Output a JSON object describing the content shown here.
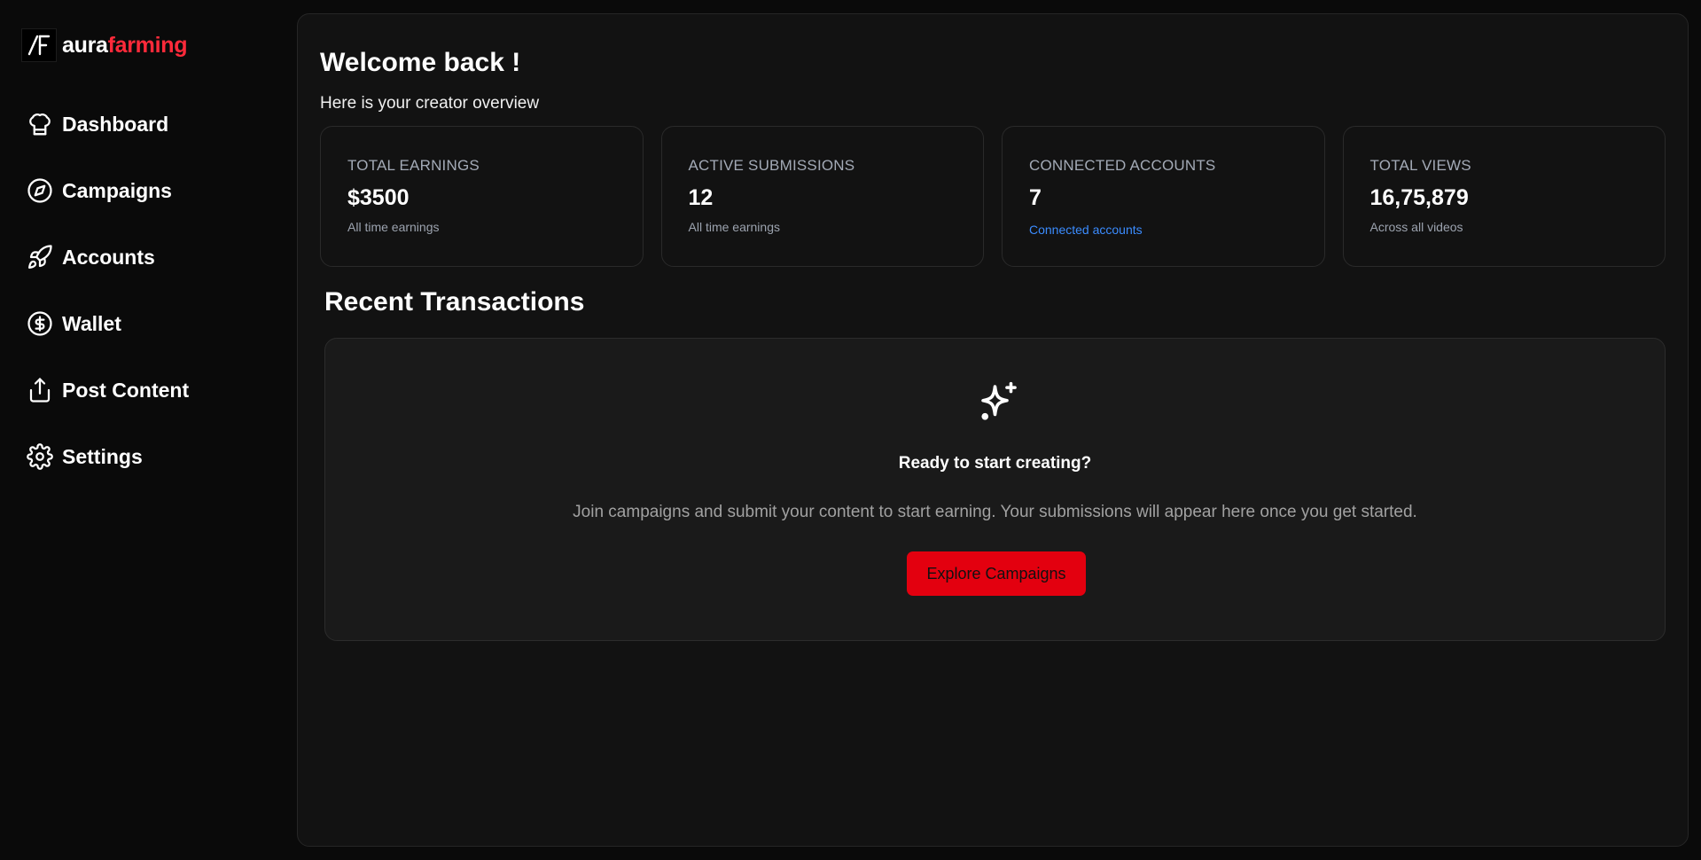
{
  "brand": {
    "name_part1": "aura",
    "name_part2": "farming",
    "logo_icon": "af-logo-icon",
    "accent_color": "#ff2a3a"
  },
  "sidebar": {
    "items": [
      {
        "label": "Dashboard",
        "icon": "chef-hat-icon"
      },
      {
        "label": "Campaigns",
        "icon": "compass-icon"
      },
      {
        "label": "Accounts",
        "icon": "rocket-icon"
      },
      {
        "label": "Wallet",
        "icon": "dollar-circle-icon"
      },
      {
        "label": "Post Content",
        "icon": "upload-icon"
      },
      {
        "label": "Settings",
        "icon": "gear-icon"
      }
    ]
  },
  "header": {
    "title": "Welcome back !",
    "subtitle": "Here is your creator overview"
  },
  "stats": [
    {
      "label": "TOTAL EARNINGS",
      "value": "$3500",
      "caption": "All time earnings"
    },
    {
      "label": "ACTIVE SUBMISSIONS",
      "value": "12",
      "caption": "All time earnings"
    },
    {
      "label": "CONNECTED ACCOUNTS",
      "value": "7",
      "caption": "Connected accounts"
    },
    {
      "label": "TOTAL VIEWS",
      "value": "16,75,879",
      "caption": "Across all videos"
    }
  ],
  "transactions": {
    "title": "Recent Transactions",
    "empty_icon": "sparkles-icon",
    "empty_title": "Ready to start creating?",
    "empty_description": "Join campaigns and submit your content to start earning. Your submissions will appear here once you get started.",
    "cta_label": "Explore Campaigns",
    "cta_color": "#e3000f"
  },
  "colors": {
    "background": "#0a0a0a",
    "panel": "#121212",
    "link": "#3b8cff"
  }
}
